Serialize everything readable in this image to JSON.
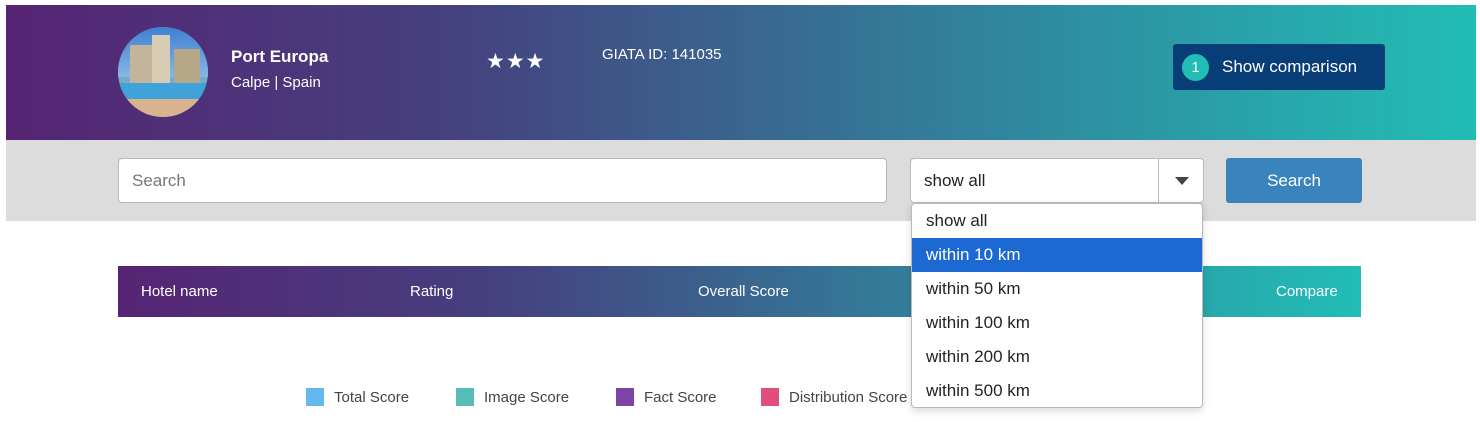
{
  "hotel": {
    "name": "Port Europa",
    "location": "Calpe | Spain",
    "stars": "★★★",
    "giata": "GIATA ID: 141035"
  },
  "compare_button": {
    "count": "1",
    "label": "Show comparison"
  },
  "search": {
    "placeholder": "Search",
    "value": "",
    "button_label": "Search"
  },
  "radius_select": {
    "value": "show all",
    "options": [
      "show all",
      "within 10 km",
      "within 50 km",
      "within 100 km",
      "within 200 km",
      "within 500 km"
    ],
    "highlighted_option": "within 10 km"
  },
  "table": {
    "columns": [
      "Hotel name",
      "Rating",
      "Overall Score",
      "Compare"
    ]
  },
  "legend": [
    {
      "label": "Total Score",
      "color": "#63b8f0"
    },
    {
      "label": "Image Score",
      "color": "#56bdb6"
    },
    {
      "label": "Fact Score",
      "color": "#7c44a6"
    },
    {
      "label": "Distribution Score",
      "color": "#e04f7c"
    }
  ],
  "colors": {
    "gradient_start": "#562474",
    "gradient_end": "#22bdb5",
    "compare_button": "#083e78",
    "search_button": "#3a84bd",
    "dropdown_highlight": "#1c69d4"
  }
}
